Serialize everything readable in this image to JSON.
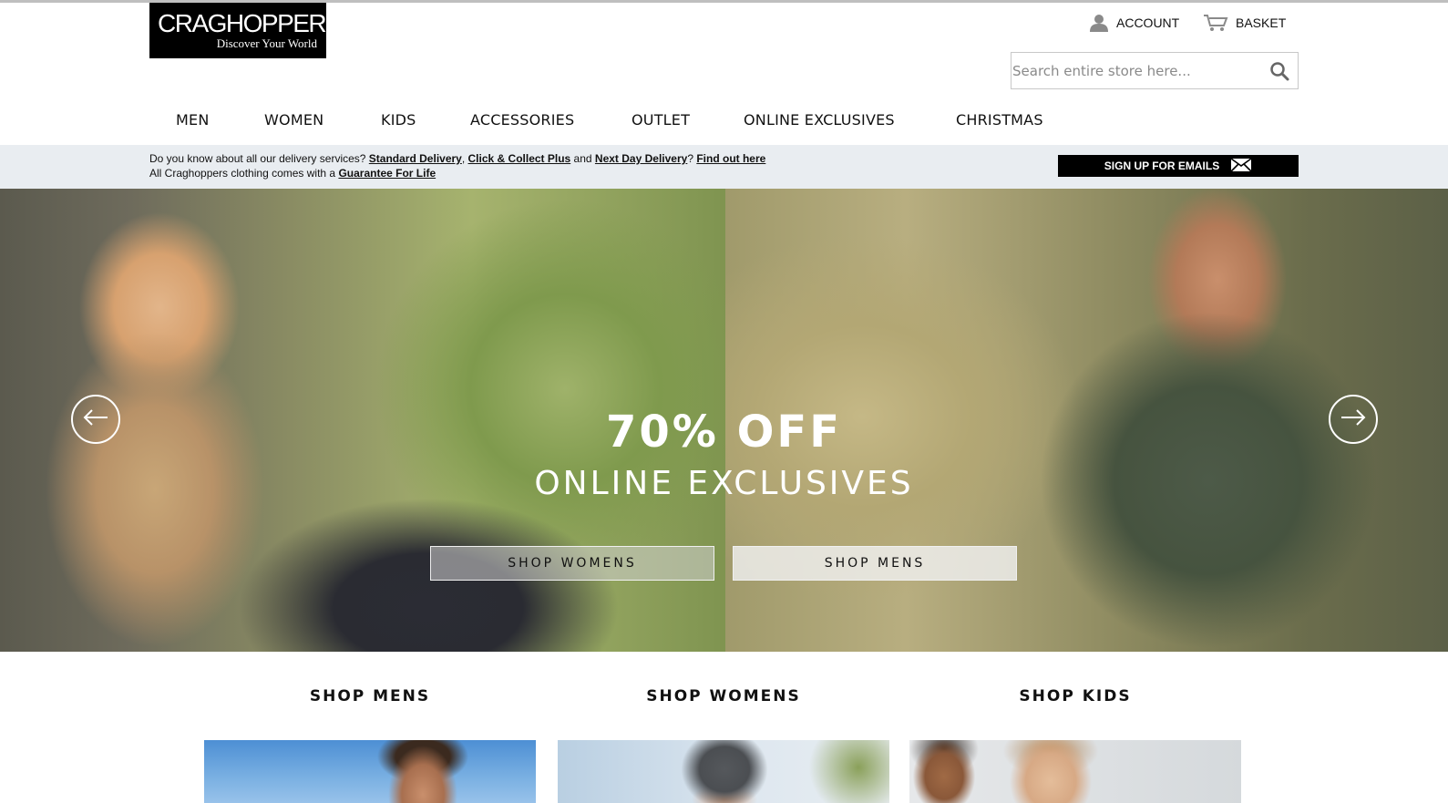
{
  "brand": {
    "name": "CRAGHOPPERS",
    "tagline": "Discover Your World"
  },
  "header": {
    "account_label": "ACCOUNT",
    "basket_label": "BASKET",
    "search_placeholder": "Search entire store here..."
  },
  "nav": {
    "items": [
      "MEN",
      "WOMEN",
      "KIDS",
      "ACCESSORIES",
      "OUTLET",
      "ONLINE EXCLUSIVES",
      "CHRISTMAS"
    ]
  },
  "infobar": {
    "l1_text1": "Do you know about all our delivery services? ",
    "l1_link1": "Standard Delivery",
    "l1_sep1": ", ",
    "l1_link2": "Click & Collect Plus",
    "l1_sep2": " and ",
    "l1_link3": "Next Day Delivery",
    "l1_sep3": "? ",
    "l1_link4": "Find out here",
    "l2_text": "All Craghoppers clothing comes with a ",
    "l2_link": "Guarantee For Life",
    "signup_label": "SIGN UP FOR EMAILS"
  },
  "hero": {
    "headline": "70% OFF",
    "subheadline": "ONLINE EXCLUSIVES",
    "shop_womens_label": "SHOP WOMENS",
    "shop_mens_label": "SHOP MENS"
  },
  "categories": {
    "mens": "SHOP MENS",
    "womens": "SHOP WOMENS",
    "kids": "SHOP KIDS"
  },
  "colors": {
    "accent": "#000000",
    "infobar_bg": "#e9edf1"
  }
}
